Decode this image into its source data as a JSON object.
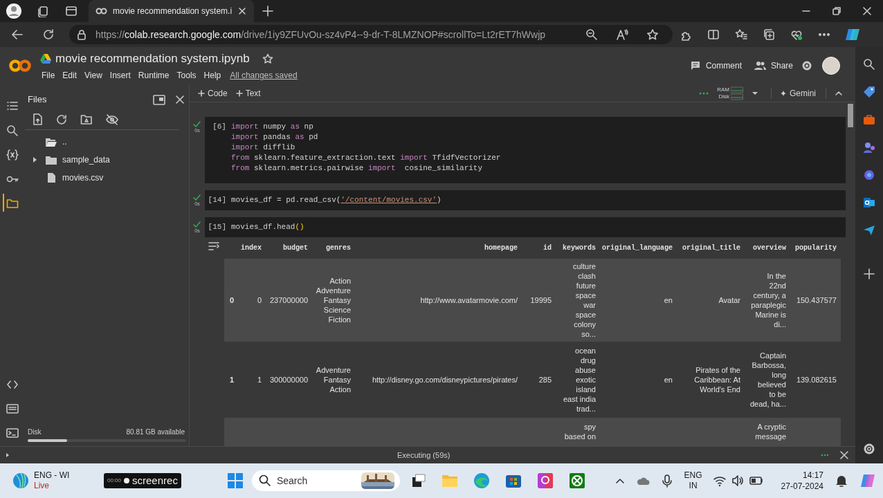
{
  "browser": {
    "tab": {
      "title": "movie recommendation system.i"
    },
    "url": {
      "scheme": "https://",
      "host": "colab.research.google.com",
      "path": "/drive/1iy9ZFUvOu-sz4vP4--9-dr-T-8LMZNOP#scrollTo=Lt2rET7hWwjp"
    }
  },
  "colab": {
    "title": "movie recommendation system.ipynb",
    "menu": [
      "File",
      "Edit",
      "View",
      "Insert",
      "Runtime",
      "Tools",
      "Help"
    ],
    "save_status": "All changes saved",
    "actions": [
      "Comment",
      "Share"
    ]
  },
  "toolbar": {
    "add": [
      "Code",
      "Text"
    ],
    "resources": [
      "RAM",
      "Disk"
    ],
    "assistant": "Gemini"
  },
  "rail": [
    {
      "kind": "toc",
      "selected": false
    },
    {
      "kind": "search",
      "selected": false
    },
    {
      "kind": "variables",
      "selected": false
    },
    {
      "kind": "secrets",
      "selected": false
    },
    {
      "kind": "files",
      "selected": true
    }
  ],
  "files": {
    "title": "Files",
    "tree": [
      {
        "kind": "parent",
        "name": ".."
      },
      {
        "kind": "folder",
        "name": "sample_data",
        "expanded": false
      },
      {
        "kind": "file",
        "name": "movies.csv"
      }
    ],
    "disk": {
      "label": "Disk",
      "available": "80.81 GB available",
      "level": 0.25
    }
  },
  "cells": [
    {
      "count": "[6]",
      "time": "0s",
      "lines": [
        [
          {
            "kind": "keyword",
            "text": "import"
          },
          {
            "kind": "plain",
            "text": " numpy "
          },
          {
            "kind": "keyword",
            "text": "as"
          },
          {
            "kind": "plain",
            "text": " np"
          }
        ],
        [
          {
            "kind": "keyword",
            "text": "import"
          },
          {
            "kind": "plain",
            "text": " pandas "
          },
          {
            "kind": "keyword",
            "text": "as"
          },
          {
            "kind": "plain",
            "text": " pd"
          }
        ],
        [
          {
            "kind": "keyword",
            "text": "import"
          },
          {
            "kind": "plain",
            "text": " difflib"
          }
        ],
        [
          {
            "kind": "keyword",
            "text": "from"
          },
          {
            "kind": "plain",
            "text": " sklearn.feature_extraction.text "
          },
          {
            "kind": "keyword",
            "text": "import"
          },
          {
            "kind": "plain",
            "text": " TfidfVectorizer"
          }
        ],
        [
          {
            "kind": "keyword",
            "text": "from"
          },
          {
            "kind": "plain",
            "text": " sklearn.metrics.pairwise "
          },
          {
            "kind": "keyword",
            "text": "import"
          },
          {
            "kind": "plain",
            "text": "  cosine_similarity"
          }
        ]
      ]
    },
    {
      "count": "[14]",
      "time": "0s",
      "lines": [
        [
          {
            "kind": "plain",
            "text": "movies_df = pd.read_csv("
          },
          {
            "kind": "string",
            "text": "'/content/movies.csv'"
          },
          {
            "kind": "plain",
            "text": ")"
          }
        ]
      ]
    },
    {
      "count": "[15]",
      "time": "0s",
      "lines": [
        [
          {
            "kind": "plain",
            "text": "movies_df.head"
          },
          {
            "kind": "paren",
            "text": "()"
          }
        ]
      ]
    }
  ],
  "output": {
    "table": {
      "columns": [
        "index",
        "budget",
        "genres",
        "homepage",
        "id",
        "keywords",
        "original_language",
        "original_title",
        "overview",
        "popularity"
      ],
      "rows": [
        {
          "label": "0",
          "cells": [
            "0",
            "237000000",
            "Action\nAdventure\nFantasy\nScience\nFiction",
            "http://www.avatarmovie.com/",
            "19995",
            "culture\nclash\nfuture\nspace\nwar\nspace\ncolony\nso...",
            "en",
            "Avatar",
            "In the\n22nd\ncentury, a\nparaplegic\nMarine is\ndi...",
            "150.437577"
          ]
        },
        {
          "label": "1",
          "cells": [
            "1",
            "300000000",
            "Adventure\nFantasy\nAction",
            "http://disney.go.com/disneypictures/pirates/",
            "285",
            "ocean\ndrug\nabuse\nexotic\nisland\neast india\ntrad...",
            "en",
            "Pirates of the\nCaribbean: At\nWorld's End",
            "Captain\nBarbossa,\nlong\nbelieved\nto be\ndead, ha...",
            "139.082615"
          ]
        },
        {
          "cells": [
            null,
            null,
            null,
            null,
            null,
            "spy\nbased on",
            null,
            null,
            "A cryptic\nmessage",
            null
          ]
        }
      ]
    }
  },
  "status_bar": {
    "text": "Executing (59s)"
  },
  "taskbar": {
    "weather": {
      "title": "ENG - WI",
      "subtitle": "Live"
    },
    "recorder": {
      "timer": "00:00",
      "brand": "screenrec"
    },
    "search": {
      "placeholder": "Search"
    },
    "language": [
      "ENG",
      "IN"
    ],
    "time": "14:17",
    "date": "27-07-2024"
  }
}
